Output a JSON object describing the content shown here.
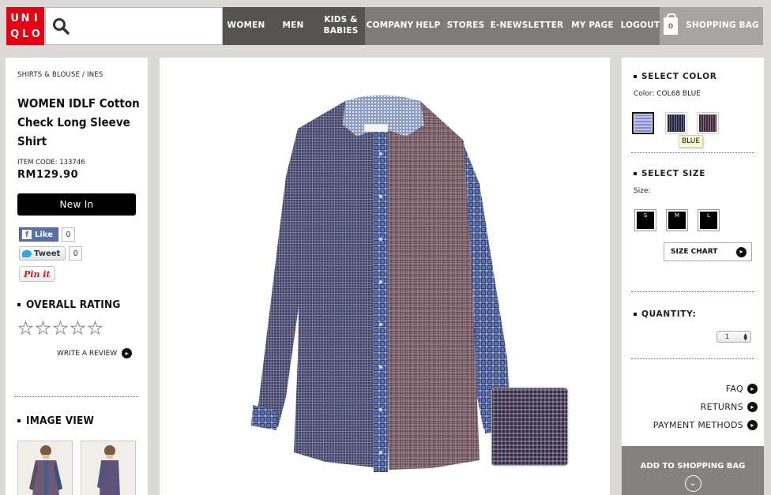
{
  "brand": {
    "logo_letters": [
      "U",
      "N",
      "I",
      "Q",
      "L",
      "O"
    ]
  },
  "nav": {
    "items": [
      {
        "label": "WOMEN"
      },
      {
        "label": "MEN"
      },
      {
        "label": "KIDS &\nBABIES"
      },
      {
        "label": "COMPANY"
      },
      {
        "label": "HELP"
      },
      {
        "label": "STORES"
      },
      {
        "label": "E-NEWSLETTER"
      },
      {
        "label": "MY PAGE"
      },
      {
        "label": "LOGOUT"
      }
    ],
    "bag_count": "0",
    "bag_label": "SHOPPING BAG"
  },
  "product": {
    "breadcrumb": "SHIRTS & BLOUSE / INES",
    "title": "WOMEN IDLF Cotton Check Long Sleeve Shirt",
    "item_code": "ITEM CODE: 133746",
    "price": "RM129.90",
    "badge": "New In"
  },
  "social": {
    "like_label": "Like",
    "like_count": "0",
    "tweet_label": "Tweet",
    "tweet_count": "0",
    "pin_label": "Pin it"
  },
  "rating": {
    "heading": "OVERALL RATING",
    "stars": 0,
    "max_stars": 5,
    "write_review": "WRITE A REVIEW"
  },
  "image_view": {
    "heading": "IMAGE VIEW"
  },
  "options": {
    "color_heading": "SELECT COLOR",
    "color_label": "Color: COL68 BLUE",
    "color_tooltip": "BLUE",
    "size_heading": "SELECT SIZE",
    "size_label": "Size:",
    "sizes": [
      "S",
      "M",
      "L"
    ],
    "size_chart": "SIZE CHART",
    "quantity_heading": "QUANTITY:",
    "quantity_value": "1"
  },
  "links": {
    "faq": "FAQ",
    "returns": "RETURNS",
    "payment": "PAYMENT METHODS"
  },
  "cta": {
    "add_to_bag": "ADD TO SHOPPING BAG"
  },
  "colors": {
    "brand_red": "#e60012",
    "nav_dark": "#555450",
    "nav_mid": "#7e7c78",
    "cta_gray": "#848280"
  }
}
